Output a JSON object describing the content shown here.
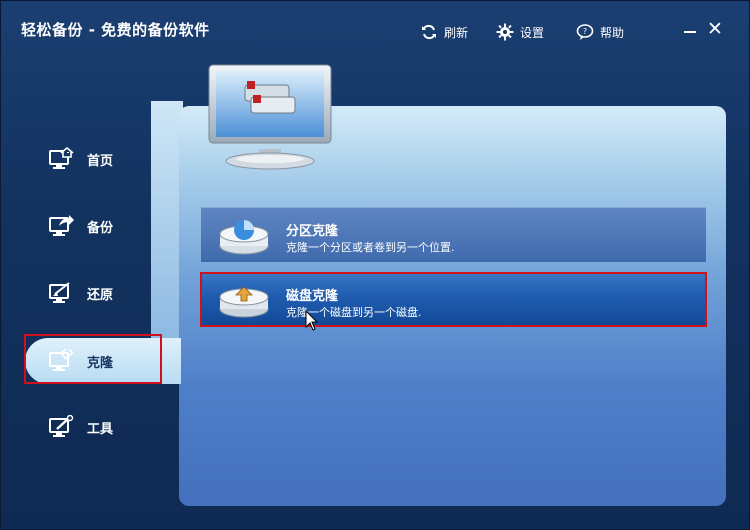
{
  "window": {
    "title": "轻松备份 - 免费的备份软件"
  },
  "toolbar": {
    "refresh_label": "刷新",
    "settings_label": "设置",
    "help_label": "帮助"
  },
  "sidebar": {
    "items": [
      {
        "label": "首页",
        "icon": "home-monitor-icon"
      },
      {
        "label": "备份",
        "icon": "backup-monitor-icon"
      },
      {
        "label": "还原",
        "icon": "restore-monitor-icon"
      },
      {
        "label": "克隆",
        "icon": "clone-monitor-icon",
        "active": true
      },
      {
        "label": "工具",
        "icon": "tools-monitor-icon"
      }
    ]
  },
  "main": {
    "cards": [
      {
        "title": "分区克隆",
        "description": "克隆一个分区或者卷到另一个位置.",
        "icon": "partition-clone-icon"
      },
      {
        "title": "磁盘克隆",
        "description": "克隆一个磁盘到另一个磁盘.",
        "icon": "disk-clone-icon",
        "highlighted": true
      }
    ]
  },
  "colors": {
    "accent": "#d0101a",
    "panel": "#4f7fc8",
    "background": "#12325f"
  }
}
